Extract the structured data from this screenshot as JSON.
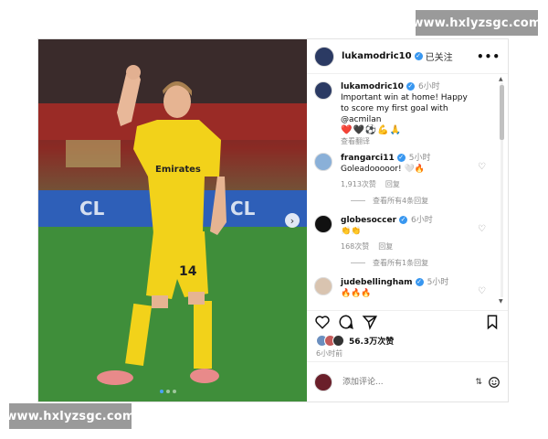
{
  "watermark": {
    "top": "www.hxlyzsgc.com",
    "bottom": "www.hxlyzsgc.com"
  },
  "post": {
    "image": {
      "jersey_sponsor": "Emirates",
      "jersey_number": "14",
      "ad_board": "CL",
      "ad_board_2": "CL",
      "carousel_dots": 3,
      "active_dot": 1,
      "next_arrow": "›"
    },
    "header": {
      "username": "lukamodric10",
      "follow_status": "已关注",
      "more": "•••"
    },
    "caption": {
      "username": "lukamodric10",
      "time": "6小时",
      "text": "Important win at home! Happy to score my first goal with @acmilan",
      "emojis": "❤️🖤⚽💪🙏",
      "translate": "查看翻译"
    },
    "comments": [
      {
        "username": "frangarci11",
        "time": "5小时",
        "text": "Goleadooooor! 🤍🔥",
        "likes": "1,913次赞",
        "reply": "回复",
        "view_replies": "查看所有4条回复"
      },
      {
        "username": "globesoccer",
        "time": "6小时",
        "text": "👏👏",
        "likes": "168次赞",
        "reply": "回复",
        "view_replies": "查看所有1条回复"
      },
      {
        "username": "judebellingham",
        "time": "5小时",
        "text": "🔥🔥🔥"
      }
    ],
    "likes": "56.3万次赞",
    "ago": "6小时前",
    "add_comment_placeholder": "添加评论...",
    "colors": {
      "verified": "#3897f0",
      "jersey": "#f2d21a",
      "active_dot": "#4aa3ff"
    }
  }
}
